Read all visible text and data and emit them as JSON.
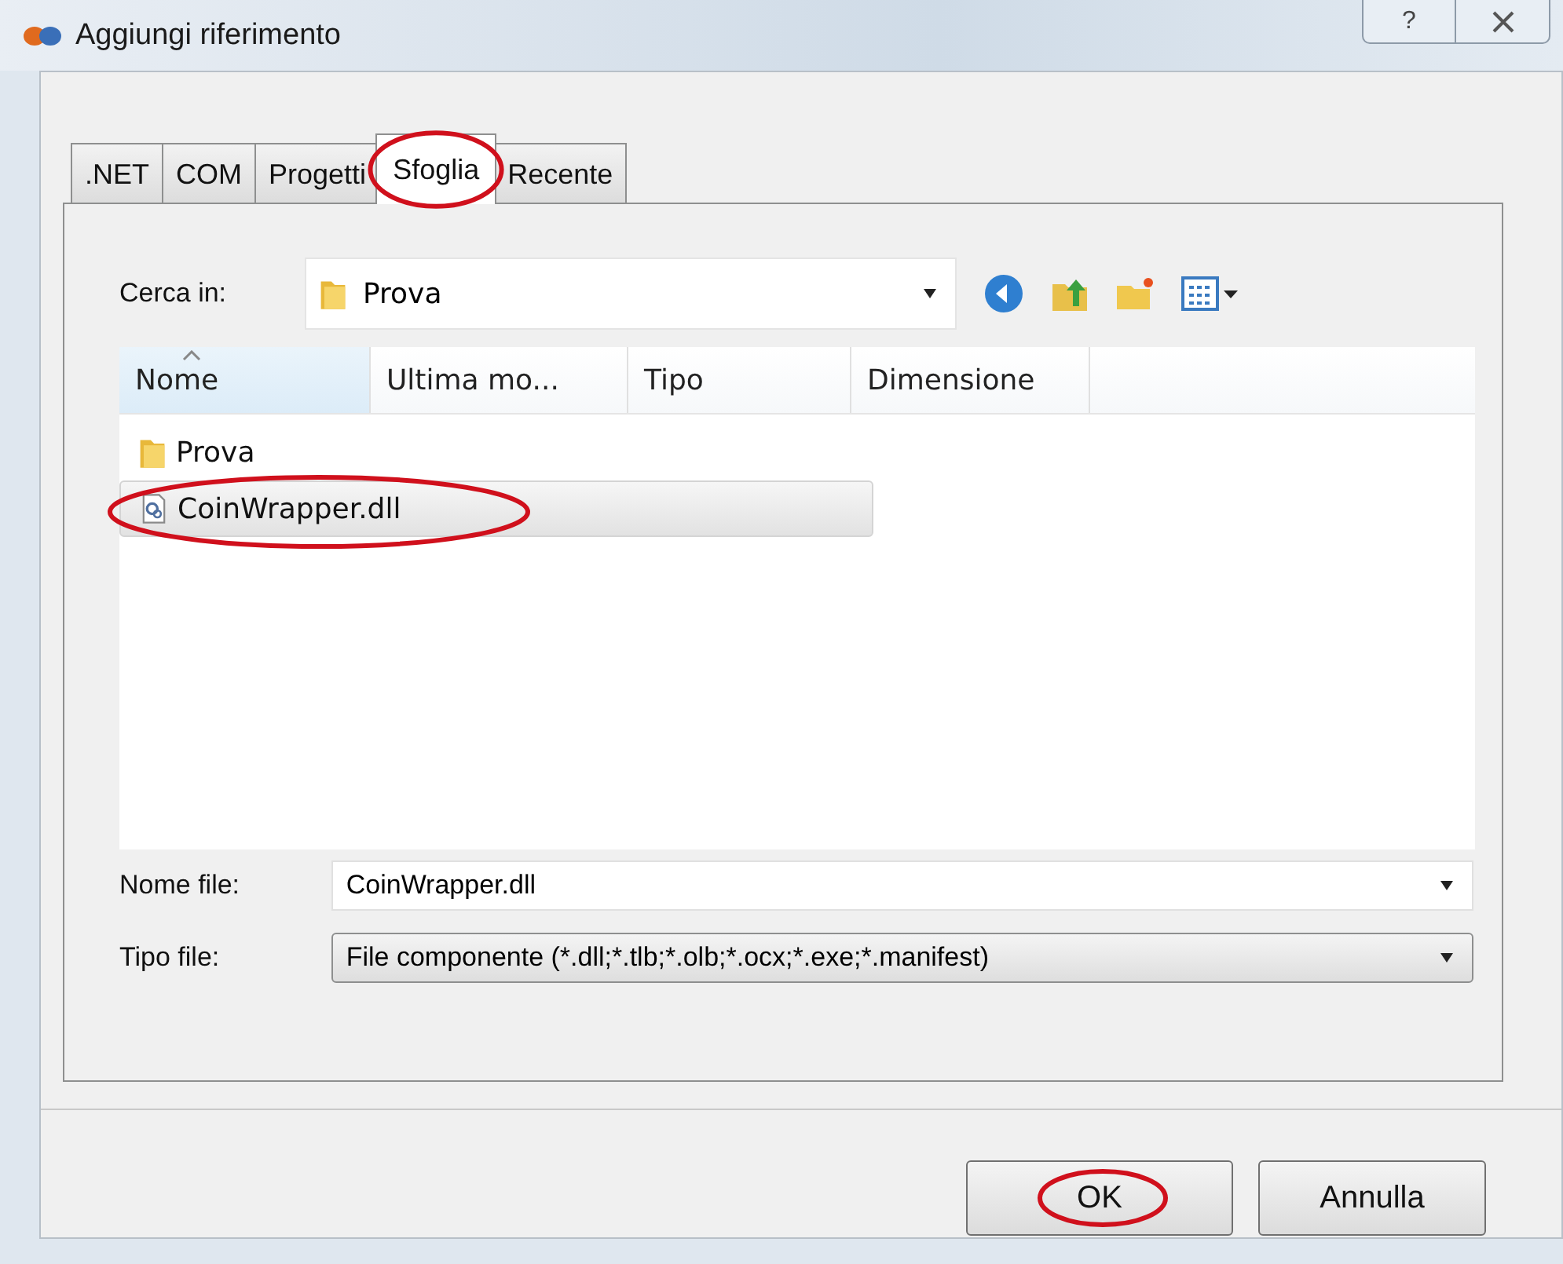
{
  "window": {
    "title": "Aggiungi riferimento",
    "help": "?"
  },
  "tabs": [
    {
      "label": ".NET",
      "selected": false,
      "annotated": false
    },
    {
      "label": "COM",
      "selected": false,
      "annotated": false
    },
    {
      "label": "Progetti",
      "selected": false,
      "annotated": false
    },
    {
      "label": "Sfoglia",
      "selected": true,
      "annotated": true
    },
    {
      "label": "Recente",
      "selected": false,
      "annotated": false
    }
  ],
  "look_in": {
    "label": "Cerca in:",
    "value": "Prova"
  },
  "file_list": {
    "columns": [
      {
        "label": "Nome",
        "sorted": true
      },
      {
        "label": "Ultima mo...",
        "sorted": false
      },
      {
        "label": "Tipo",
        "sorted": false
      },
      {
        "label": "Dimensione",
        "sorted": false
      }
    ],
    "rows": [
      {
        "kind": "folder",
        "name": "Prova",
        "selected": false,
        "annotated": false
      },
      {
        "kind": "dll",
        "name": "CoinWrapper.dll",
        "selected": true,
        "annotated": true
      }
    ]
  },
  "file_name": {
    "label": "Nome file:",
    "value": "CoinWrapper.dll"
  },
  "file_type": {
    "label": "Tipo file:",
    "value": "File componente (*.dll;*.tlb;*.olb;*.ocx;*.exe;*.manifest)"
  },
  "buttons": [
    {
      "label": "OK",
      "annotated": true
    },
    {
      "label": "Annulla",
      "annotated": false
    }
  ]
}
